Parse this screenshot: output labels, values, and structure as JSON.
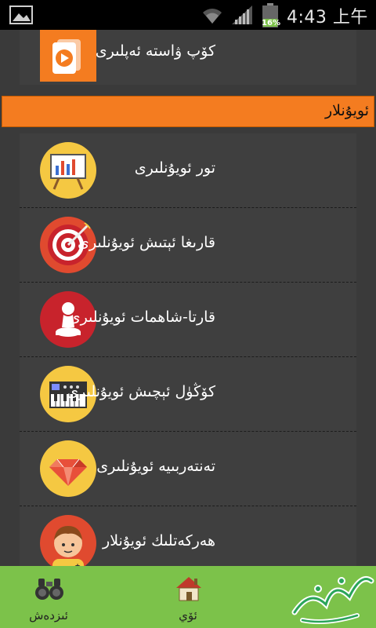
{
  "status_bar": {
    "time": "4:43 上午",
    "battery_label": "16%"
  },
  "top_item": {
    "label": "كۆپ ۋاستە ئەپلىرى",
    "icon": "video-play-icon",
    "tile_color": "#f47c20"
  },
  "section_header": {
    "title": "ئويۇنلار",
    "color": "#f47c20"
  },
  "games": [
    {
      "label": "تور ئويۇنلىرى",
      "icon": "presentation-board-icon",
      "circle_color": "#f5c842"
    },
    {
      "label": "قارىغا ئېتىش ئويۇنلىرى",
      "icon": "target-arrow-icon",
      "circle_color": "#e04a2f"
    },
    {
      "label": "قارتا-شاھمات ئويۇنلىرى",
      "icon": "chess-pawn-icon",
      "circle_color": "#c8232c"
    },
    {
      "label": "كۆڭۈل ئېچىش ئويۇنلىرى",
      "icon": "keyboard-synth-icon",
      "circle_color": "#f5c842"
    },
    {
      "label": "تەنتەربىيە ئويۇنلىرى",
      "icon": "diamond-gem-icon",
      "circle_color": "#f5c842"
    },
    {
      "label": "ھەركەتلىك ئويۇنلار",
      "icon": "kid-face-icon",
      "circle_color": "#e04a2f"
    }
  ],
  "bottom_nav": {
    "explore_label": "ئىزدەش",
    "home_label": "ئۆي",
    "background": "#7cc24a"
  }
}
